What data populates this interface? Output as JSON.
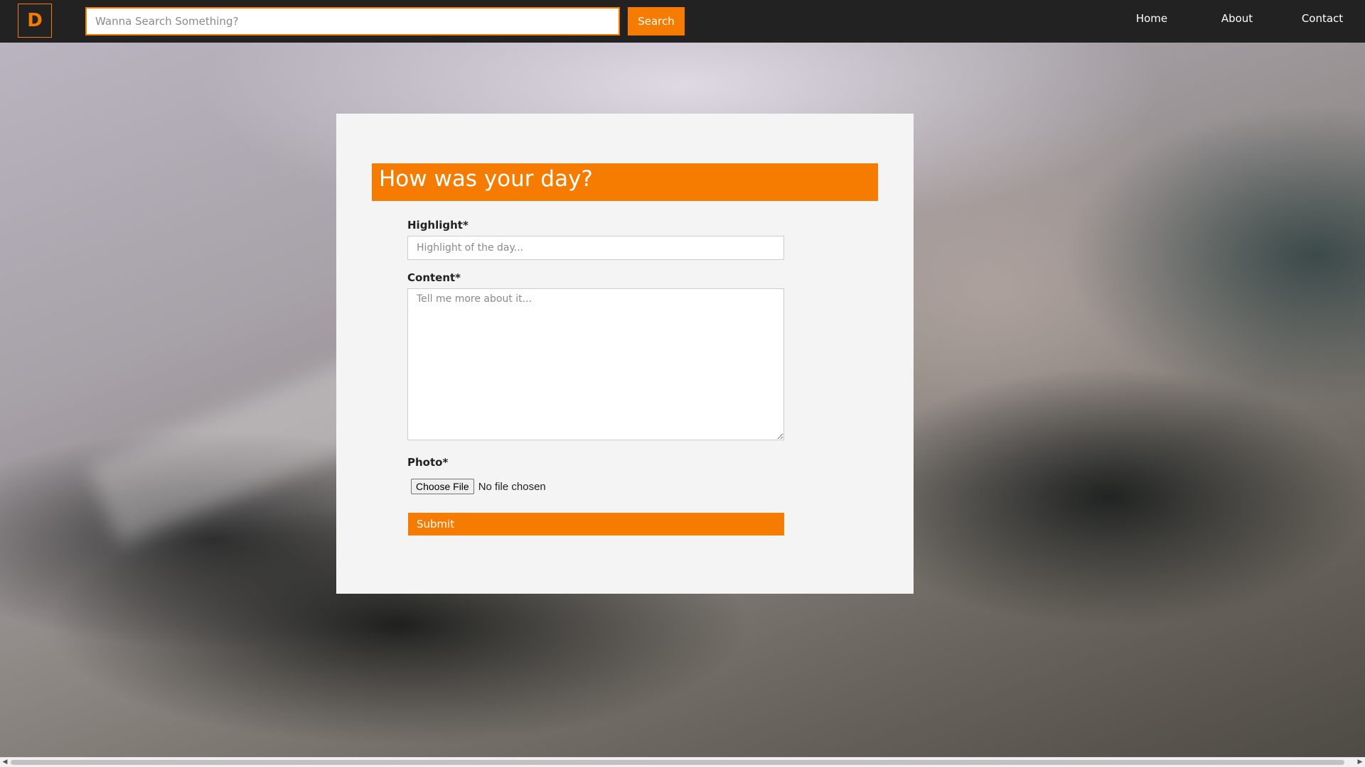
{
  "navbar": {
    "logo_letter": "D",
    "search": {
      "placeholder": "Wanna Search Something?",
      "value": "",
      "button_label": "Search"
    },
    "links": [
      {
        "label": "Home"
      },
      {
        "label": "About"
      },
      {
        "label": "Contact"
      }
    ]
  },
  "form": {
    "title": "How was your day?",
    "highlight": {
      "label": "Highlight*",
      "placeholder": "Highlight of the day...",
      "value": ""
    },
    "content": {
      "label": "Content*",
      "placeholder": "Tell me more about it...",
      "value": ""
    },
    "photo": {
      "label": "Photo*",
      "choose_button_label": "Choose File",
      "status": "No file chosen"
    },
    "submit_label": "Submit"
  },
  "scrollbar": {
    "left_arrow_icon": "triangle-left-icon",
    "right_arrow_icon": "triangle-right-icon"
  },
  "colors": {
    "accent": "#f57c00",
    "navbar_bg": "#222222",
    "card_bg": "#f4f4f4"
  }
}
